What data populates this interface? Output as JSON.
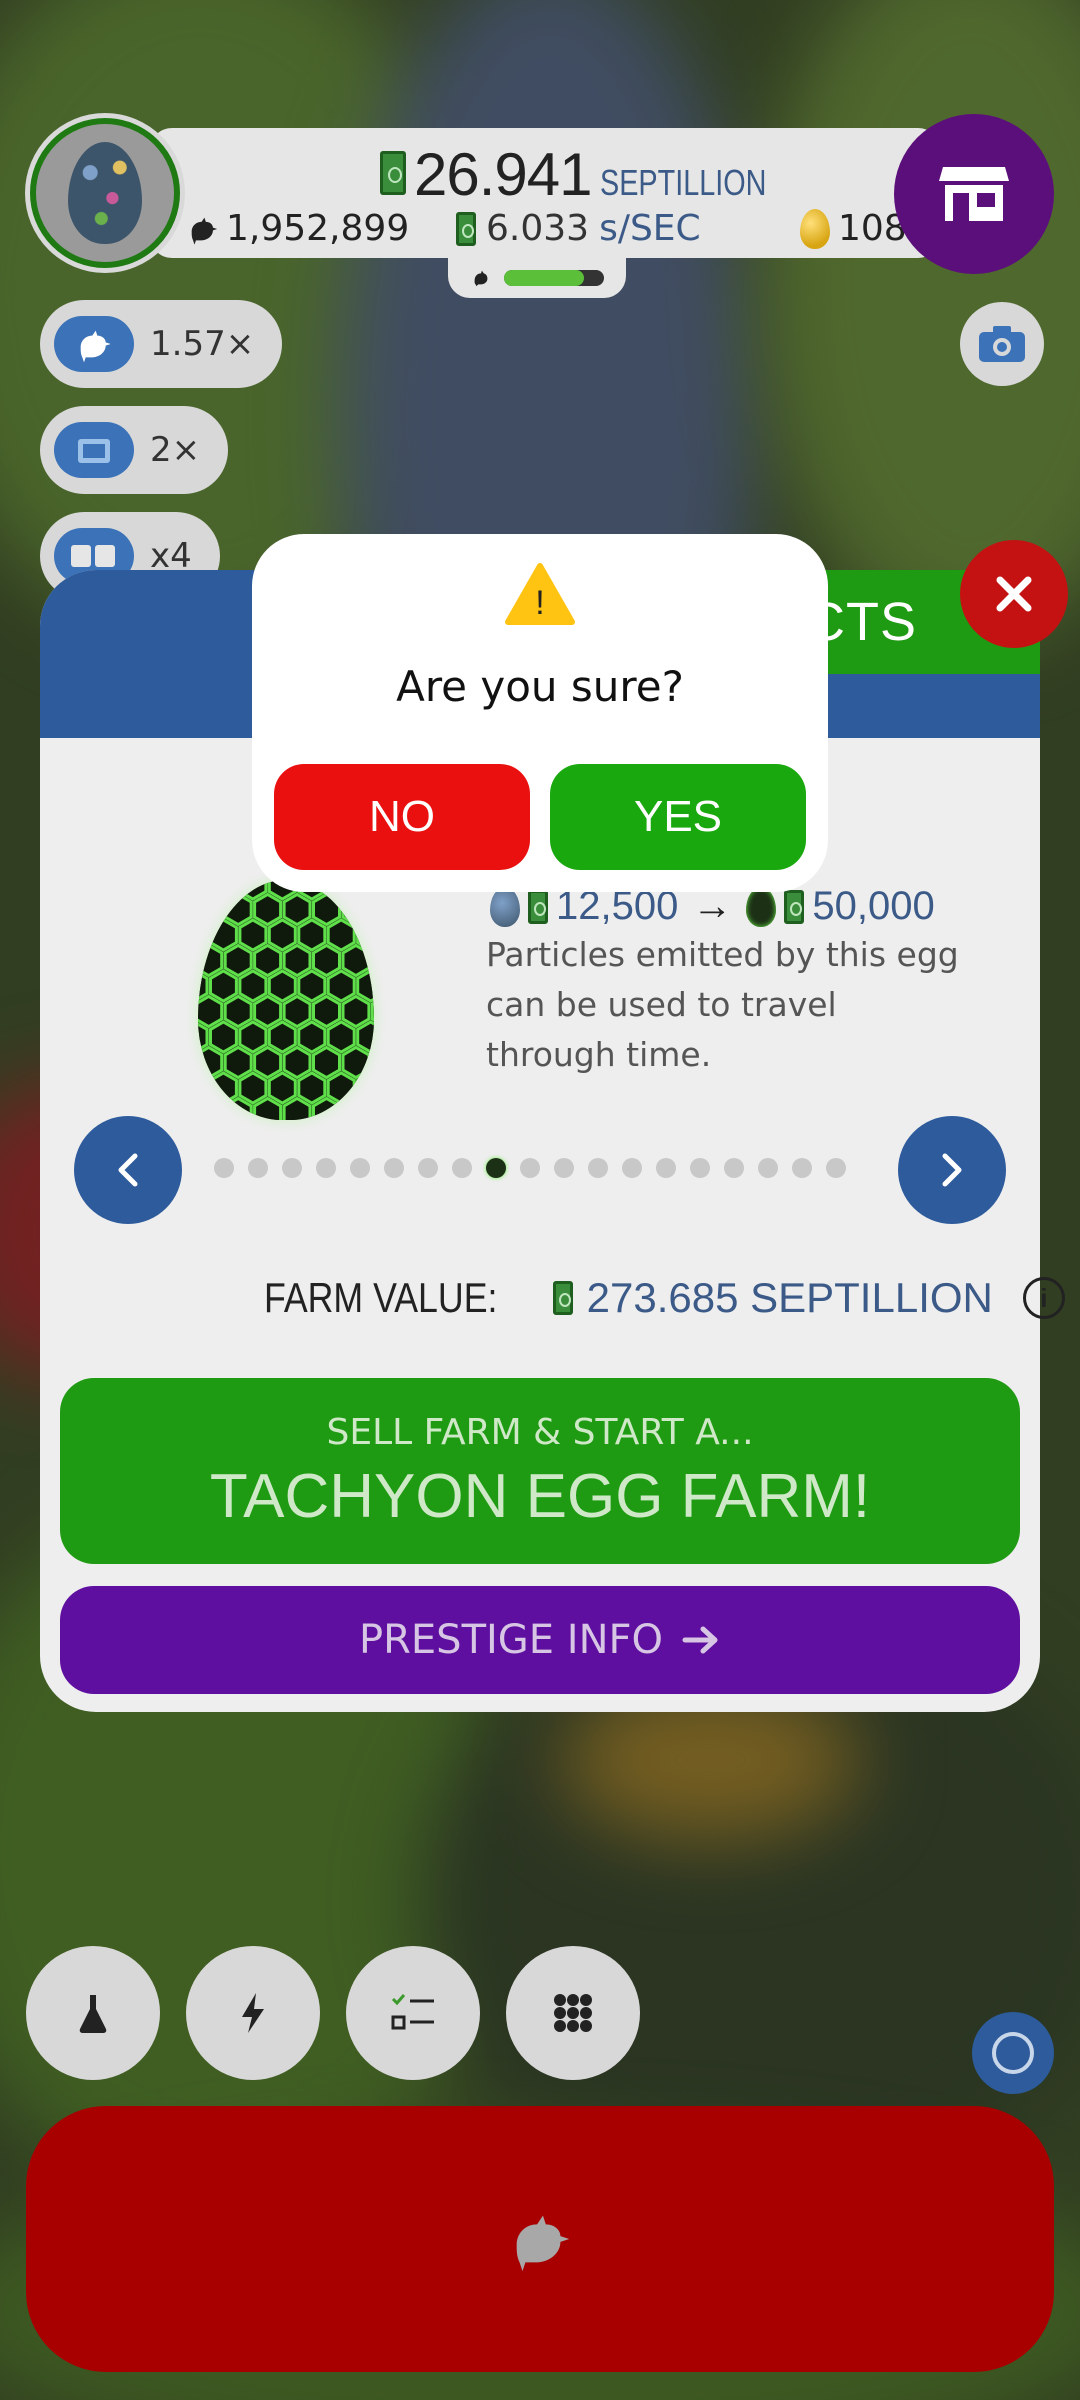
{
  "hud": {
    "money_value": "26.941",
    "money_unit": "SEPTILLION",
    "chickens": "1,952,899",
    "rate_value": "6.033",
    "rate_unit": "s/SEC",
    "golden_eggs": "108",
    "chicken_progress": 0.8
  },
  "boosts": {
    "chicken_multiplier": "1.57×",
    "video_multiplier": "2×",
    "third_multiplier": "x4"
  },
  "panel": {
    "tab_label": "CTS",
    "trade_from": "12,500",
    "trade_to": "50,000",
    "egg_description": "Particles emitted by this egg can be used to travel through time.",
    "egg_dot_count": 19,
    "selected_dot_index": 8,
    "farm_value_label": "FARM VALUE:",
    "farm_value": "273.685 SEPTILLION",
    "sell_line1": "SELL FARM & START A...",
    "sell_line2": "TACHYON EGG FARM!",
    "prestige_info": "PRESTIGE INFO"
  },
  "dialog": {
    "warning_mark": "!",
    "title": "Are you sure?",
    "no_label": "NO",
    "yes_label": "YES"
  },
  "colors": {
    "no": "#ea1010",
    "yes": "#1aa80f",
    "panel_blue": "#2d5b9b",
    "prestige_purple": "#5e0fa0",
    "hatch_red": "#a80000"
  },
  "icons": [
    "shop-icon",
    "camera-icon",
    "close-icon",
    "warning-icon",
    "research-icon",
    "boost-icon",
    "checklist-icon",
    "grid-icon",
    "chicken-icon"
  ]
}
